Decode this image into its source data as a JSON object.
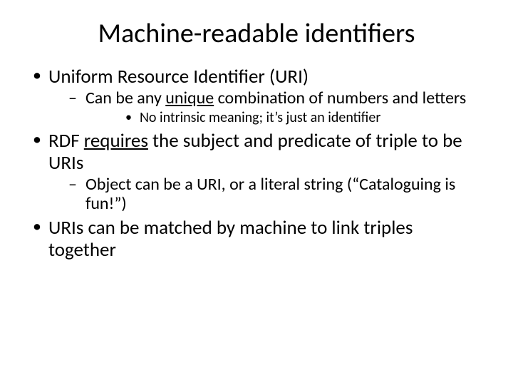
{
  "title": "Machine-readable identifiers",
  "b1": {
    "text": "Uniform Resource Identifier (URI)",
    "sub1_pre": "Can be any ",
    "sub1_u": "unique",
    "sub1_post": " combination of numbers and letters",
    "sub1a": "No intrinsic meaning; it’s just an identifier"
  },
  "b2": {
    "pre": "RDF ",
    "u": "requires",
    "post": " the subject and predicate of triple to be URIs",
    "sub1": "Object can be a URI, or a literal string (“Cataloguing is fun!”)"
  },
  "b3": "URIs can be matched by machine to link triples together"
}
